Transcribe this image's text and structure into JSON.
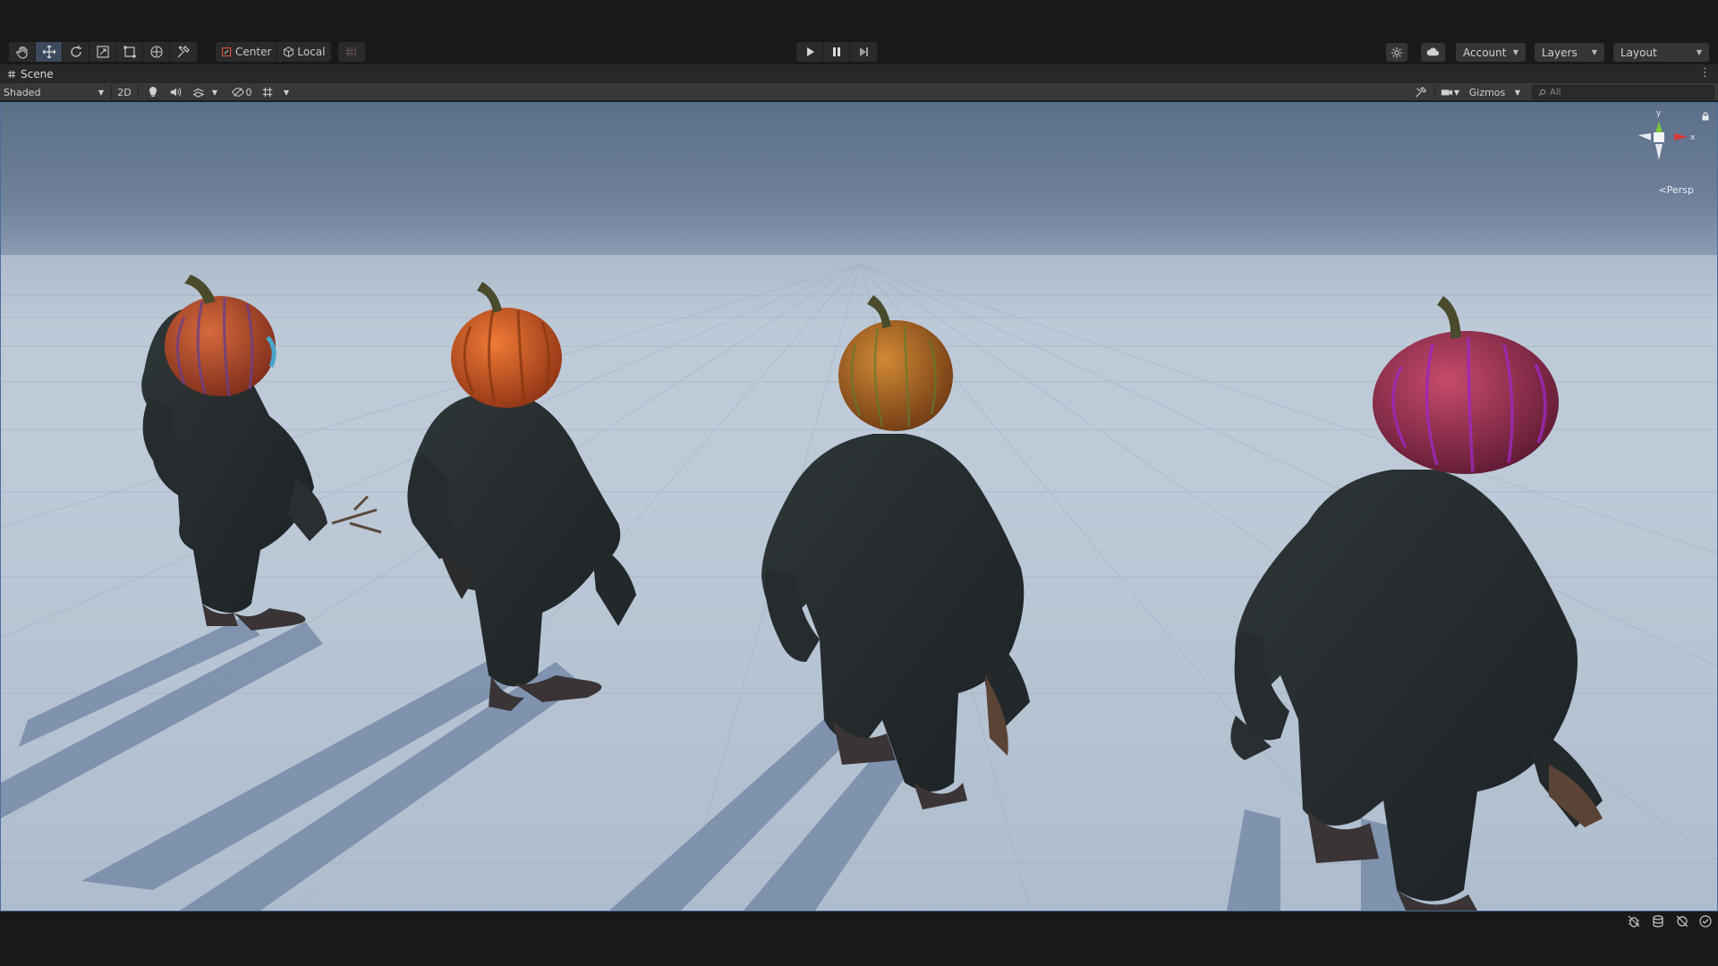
{
  "toolbar": {
    "pivot_label": "Center",
    "space_label": "Local",
    "account_label": "Account",
    "layers_label": "Layers",
    "layout_label": "Layout"
  },
  "scene_tab": {
    "label": "Scene"
  },
  "scene_bar": {
    "draw_mode": "Shaded",
    "toggle_2d": "2D",
    "hidden_count": "0",
    "gizmos_label": "Gizmos",
    "search_placeholder": "All"
  },
  "gizmo": {
    "y_label": "y",
    "x_label": "x",
    "projection_label": "Persp"
  },
  "colors": {
    "axis_x": "#d9383a",
    "axis_y": "#7cc53d",
    "selection_border": "#4a6e9a",
    "pumpkin_1": "#b34a2c",
    "pumpkin_2": "#d0602a",
    "pumpkin_3": "#b0651f",
    "pumpkin_4": "#a33150"
  }
}
